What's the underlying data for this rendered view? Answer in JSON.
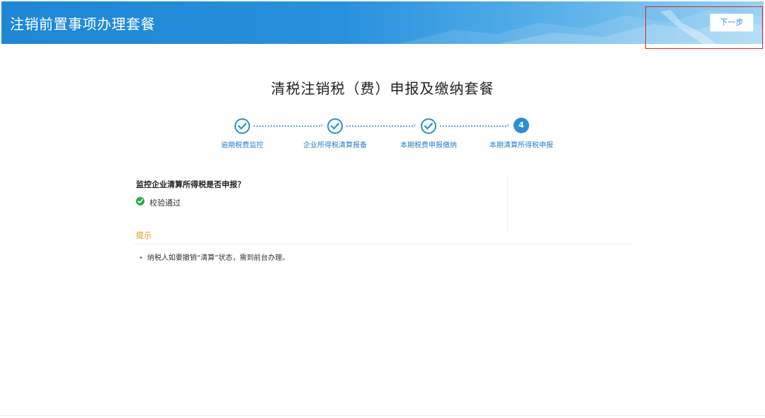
{
  "header": {
    "title": "注销前置事项办理套餐",
    "next_button_label": "下一步"
  },
  "page": {
    "title": "清税注销税（费）申报及缴纳套餐"
  },
  "steps": [
    {
      "number": "1",
      "label": "逾期税费监控",
      "status": "done"
    },
    {
      "number": "2",
      "label": "企业所得税清算报备",
      "status": "done"
    },
    {
      "number": "3",
      "label": "本期税费申报缴纳",
      "status": "done"
    },
    {
      "number": "4",
      "label": "本期清算所得税申报",
      "status": "current"
    }
  ],
  "check": {
    "question": "监控企业清算所得税是否申报？",
    "result": "校验通过"
  },
  "tips": {
    "title": "提示",
    "items": [
      "纳税人如要撤销“清算”状态，需到前台办理。"
    ]
  },
  "colors": {
    "header_start": "#1e87d6",
    "accent_blue": "#2b8fd6",
    "success_green": "#2ea84a",
    "tip_orange": "#e0901a",
    "highlight_red": "#e02525"
  },
  "icons": {
    "completed_step": "check-icon",
    "verification": "check-circle-icon",
    "connector": "chevron-right-icon"
  }
}
